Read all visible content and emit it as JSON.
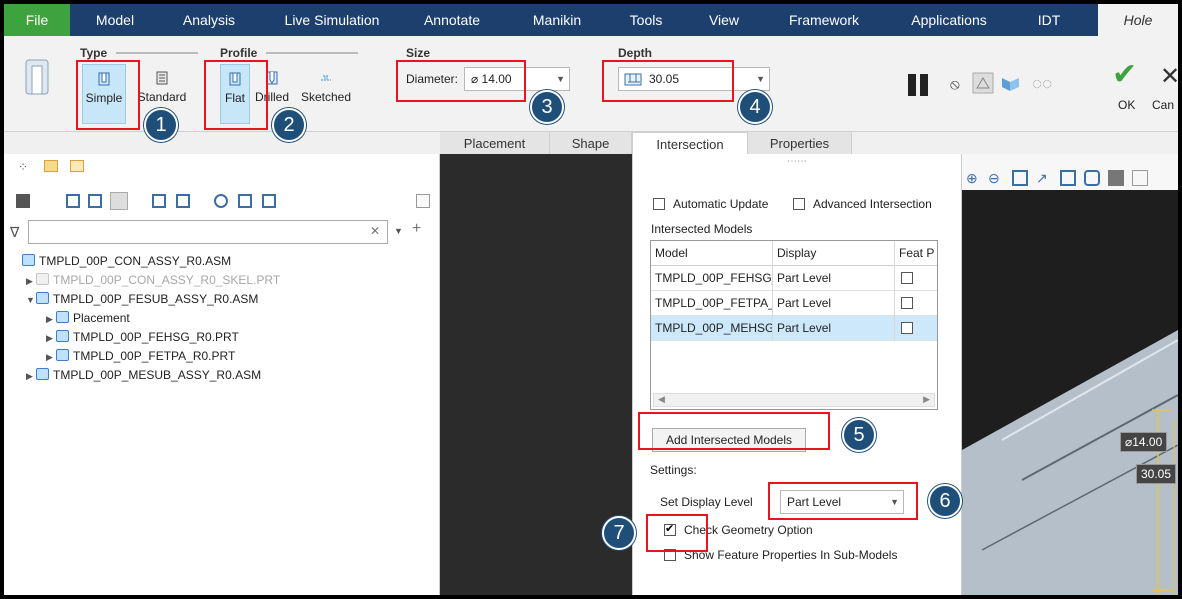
{
  "ribbon_tabs": [
    {
      "label": "File"
    },
    {
      "label": "Model"
    },
    {
      "label": "Analysis"
    },
    {
      "label": "Live Simulation"
    },
    {
      "label": "Annotate"
    },
    {
      "label": "Manikin"
    },
    {
      "label": "Tools"
    },
    {
      "label": "View"
    },
    {
      "label": "Framework"
    },
    {
      "label": "Applications"
    },
    {
      "label": "IDT"
    },
    {
      "label": "Hole"
    }
  ],
  "type_group": {
    "title": "Type",
    "simple": "Simple",
    "standard": "Standard"
  },
  "profile_group": {
    "title": "Profile",
    "flat": "Flat",
    "drilled": "Drilled",
    "sketched": "Sketched"
  },
  "size_group": {
    "title": "Size",
    "diameter_label": "Diameter:",
    "diameter_value": "⌀ 14.00"
  },
  "depth_group": {
    "title": "Depth",
    "depth_value": "30.05"
  },
  "actions": {
    "ok": "OK",
    "cancel": "Can"
  },
  "sub_tabs": [
    {
      "label": "Placement"
    },
    {
      "label": "Shape"
    },
    {
      "label": "Intersection"
    },
    {
      "label": "Properties"
    }
  ],
  "tree": {
    "filter_placeholder": "",
    "items": [
      {
        "label": "TMPLD_00P_CON_ASSY_R0.ASM"
      },
      {
        "label": "TMPLD_00P_CON_ASSY_R0_SKEL.PRT"
      },
      {
        "label": "TMPLD_00P_FESUB_ASSY_R0.ASM"
      },
      {
        "label": "Placement"
      },
      {
        "label": "TMPLD_00P_FEHSG_R0.PRT"
      },
      {
        "label": "TMPLD_00P_FETPA_R0.PRT"
      },
      {
        "label": "TMPLD_00P_MESUB_ASSY_R0.ASM"
      }
    ]
  },
  "intersection": {
    "drag_handle": "⋯⋯",
    "automatic_update": "Automatic Update",
    "advanced_intersection": "Advanced Intersection",
    "intersected_models_label": "Intersected Models",
    "columns": [
      "Model",
      "Display",
      "Feat P"
    ],
    "rows": [
      {
        "model": "TMPLD_00P_FEHSG_",
        "display": "Part Level"
      },
      {
        "model": "TMPLD_00P_FETPA_I",
        "display": "Part Level"
      },
      {
        "model": "TMPLD_00P_MEHSG",
        "display": "Part Level"
      }
    ],
    "add_button": "Add Intersected Models",
    "settings_label": "Settings:",
    "set_display_level_label": "Set Display Level",
    "display_level_value": "Part Level",
    "check_geometry": "Check Geometry Option",
    "show_feature_props": "Show Feature Properties In Sub-Models"
  },
  "viewport": {
    "dim_diameter": "⌀14.00",
    "dim_depth": "30.05"
  },
  "badges": [
    "1",
    "2",
    "3",
    "4",
    "5",
    "6",
    "7"
  ],
  "colors": {
    "accent_red": "#e8141e",
    "badge": "#1f4e79",
    "ribbon": "#1c3f6e",
    "file_tab": "#3ea33e"
  }
}
